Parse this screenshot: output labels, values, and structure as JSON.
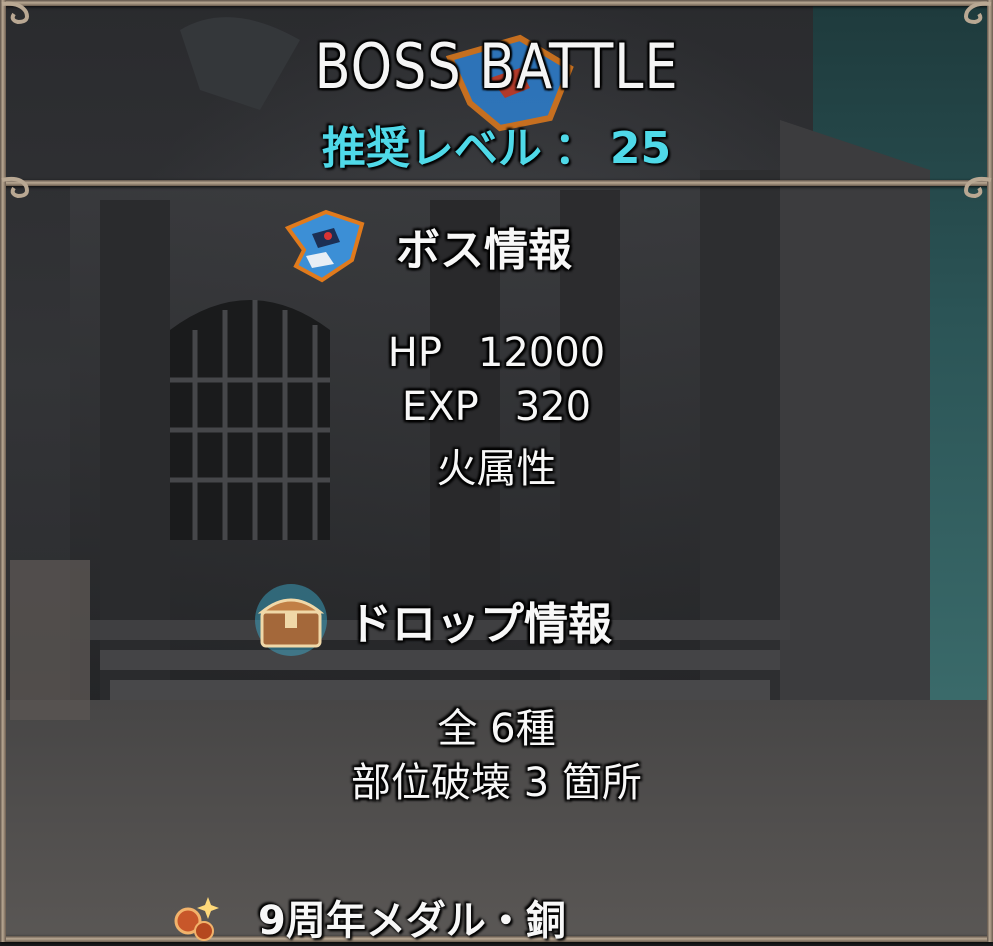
{
  "header": {
    "title": "BOSS BATTLE",
    "level_label": "推奨レベル",
    "level_separator": "：",
    "level_value": "25"
  },
  "boss_section": {
    "icon": "boss-head-icon",
    "heading": "ボス情報",
    "hp_label": "HP",
    "hp_value": "12000",
    "exp_label": "EXP",
    "exp_value": "320",
    "attribute": "火属性"
  },
  "drop_section": {
    "icon": "treasure-chest-icon",
    "heading": "ドロップ情報",
    "total_prefix": "全",
    "total_value": "6種",
    "break_label": "部位破壊",
    "break_count": "3",
    "break_suffix": "箇所"
  },
  "reward": {
    "icon": "medal-icon",
    "label": "9周年メダル・銅"
  },
  "colors": {
    "title_text": "#f4f4f4",
    "level_text": "#4fd9e8",
    "frame_gold": "#b9a893",
    "boss_icon_blue": "#3c8fd6",
    "boss_icon_glow": "#e07a1c"
  }
}
